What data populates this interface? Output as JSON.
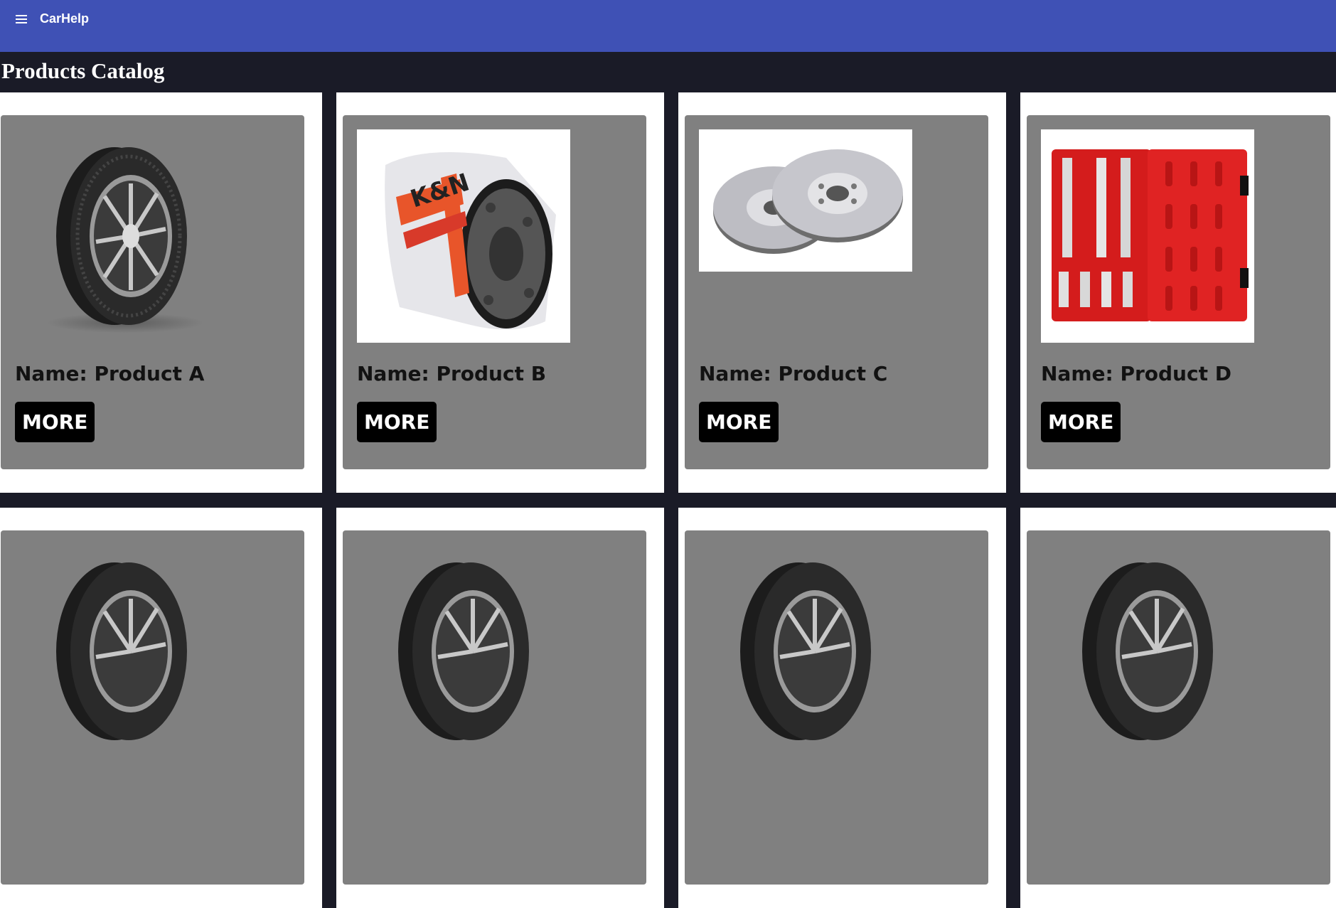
{
  "appbar": {
    "title": "CarHelp",
    "menu_icon": "menu-icon"
  },
  "page": {
    "title": "Products Catalog"
  },
  "colors": {
    "appbar": "#3f51b5",
    "background": "#1a1b27",
    "card": "#ffffff",
    "card_inner": "#808080",
    "button": "#000000"
  },
  "products": [
    {
      "name": "Name: Product A",
      "button": "MORE",
      "image": "tire-image"
    },
    {
      "name": "Name: Product B",
      "button": "MORE",
      "image": "oil-filter-image"
    },
    {
      "name": "Name: Product C",
      "button": "MORE",
      "image": "brake-discs-image"
    },
    {
      "name": "Name: Product D",
      "button": "MORE",
      "image": "socket-set-case-image"
    },
    {
      "name": "",
      "button": "",
      "image": "tire-image"
    },
    {
      "name": "",
      "button": "",
      "image": "tire-image"
    },
    {
      "name": "",
      "button": "",
      "image": "tire-image"
    },
    {
      "name": "",
      "button": "",
      "image": "tire-image"
    }
  ]
}
